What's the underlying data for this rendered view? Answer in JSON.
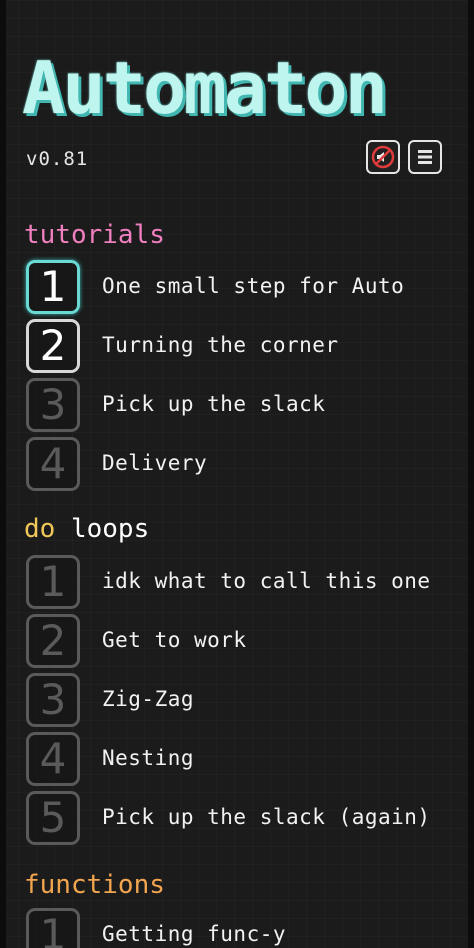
{
  "app": {
    "title": "Automaton",
    "version": "v0.81"
  },
  "toolbar": {
    "sound_icon": "sound-muted-icon",
    "menu_icon": "hamburger-menu-icon"
  },
  "sections": {
    "tutorials": {
      "heading": "tutorials",
      "color": "#f07fbf",
      "levels": [
        {
          "number": "1",
          "title": "One small step for Auto",
          "state": "current"
        },
        {
          "number": "2",
          "title": "Turning the corner",
          "state": "done"
        },
        {
          "number": "3",
          "title": "Pick up the slack",
          "state": "locked"
        },
        {
          "number": "4",
          "title": "Delivery",
          "state": "locked"
        }
      ]
    },
    "loops": {
      "heading_keyword": "do",
      "heading_rest": "loops",
      "keyword_color": "#f0c85a",
      "levels": [
        {
          "number": "1",
          "title": "idk what to call this one",
          "state": "locked"
        },
        {
          "number": "2",
          "title": "Get to work",
          "state": "locked"
        },
        {
          "number": "3",
          "title": "Zig-Zag",
          "state": "locked"
        },
        {
          "number": "4",
          "title": "Nesting",
          "state": "locked"
        },
        {
          "number": "5",
          "title": "Pick up the slack (again)",
          "state": "locked"
        }
      ]
    },
    "functions": {
      "heading": "functions",
      "color": "#f2a54f",
      "levels": [
        {
          "number": "1",
          "title": "Getting func-y",
          "state": "locked"
        }
      ]
    }
  },
  "colors": {
    "accent_cyan": "#6ad9d4",
    "logo": "#bff5ef",
    "locked": "#5a5a5a",
    "sound_icon_red": "#e03b3b"
  }
}
